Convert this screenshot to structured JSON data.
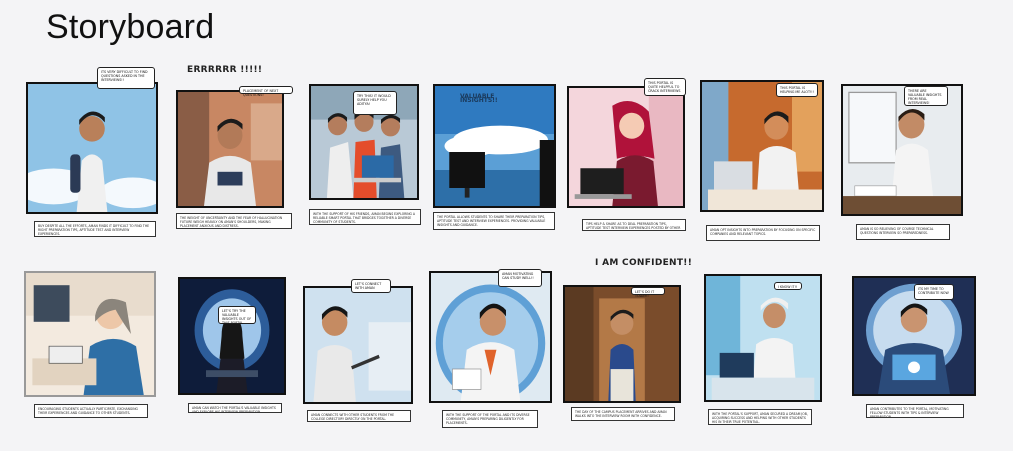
{
  "title": "Storyboard",
  "shouts": {
    "row1": "ERRRRRR !!!!!",
    "row2": "I AM CONFIDENT!!"
  },
  "panels": [
    {
      "bubble": "Its very difficult to find questions asked in the interviews!!",
      "caption": "Buy despite all the efforts, aman finds it difficult to find the right preparation tips, aptitude test and interview experiences."
    },
    {
      "bubble": "Placement of next questions!",
      "caption": "The weight of uncertainty and the fear of hallucination future weigh heavily on aman's shoulders, making placement anxious and distress."
    },
    {
      "bubble": "Try this! It would surely help you Aditya!",
      "caption": "With the support of his friends, Aman begins exploring a reliable smart portal that bridges together a diverse community of students."
    },
    {
      "bubble": "VALUABLE INSIGHTS!!",
      "caption": "The portal allows students to share their preparation tips, aptitude test and interview experiences. Providing valuable insights and guidance."
    },
    {
      "bubble": "This portal is quite helpful to crack interviews",
      "caption": "Tips help & share as to deal preparation tips, aptitude test interview experiences posted by other students."
    },
    {
      "bubble": "This portal is helping me alot!!!",
      "caption": "Aman opt insights into preparation by focusing on specific companies and relevant topics."
    },
    {
      "bubble": "There are valuable insights from real interviews!",
      "caption": "Aman is so relieving of course technical questions interview so preparedness."
    },
    {
      "bubble": "",
      "caption": "Encouraging students actually participate, exchanging their experiences and guidance to other students."
    },
    {
      "bubble": "Let's try the valuable insights out of this portal",
      "caption": "Aman can watch the portal's valuable insights and explore his interview preparation."
    },
    {
      "bubble": "Let's connect with Aman",
      "caption": "Aman connects with other students from the college directory directly on the portal."
    },
    {
      "bubble": "Aman motivating can study well!!",
      "caption": "With the support of the portal and its diverse community, Aman's preparing diligently for placements."
    },
    {
      "bubble": "Let's do it today!!",
      "caption": "The day of the campus placement arrives and Aman walks into the interview room with confidence."
    },
    {
      "bubble": "I know it!!",
      "caption": "With the portal's support, Aman secured a dream job, acquiring success and helping with other students his in their true potential."
    },
    {
      "bubble": "Its my time to contribute now",
      "caption": "Aman contributes to the portal, motivating fellow students with tips & interview preparation."
    }
  ]
}
